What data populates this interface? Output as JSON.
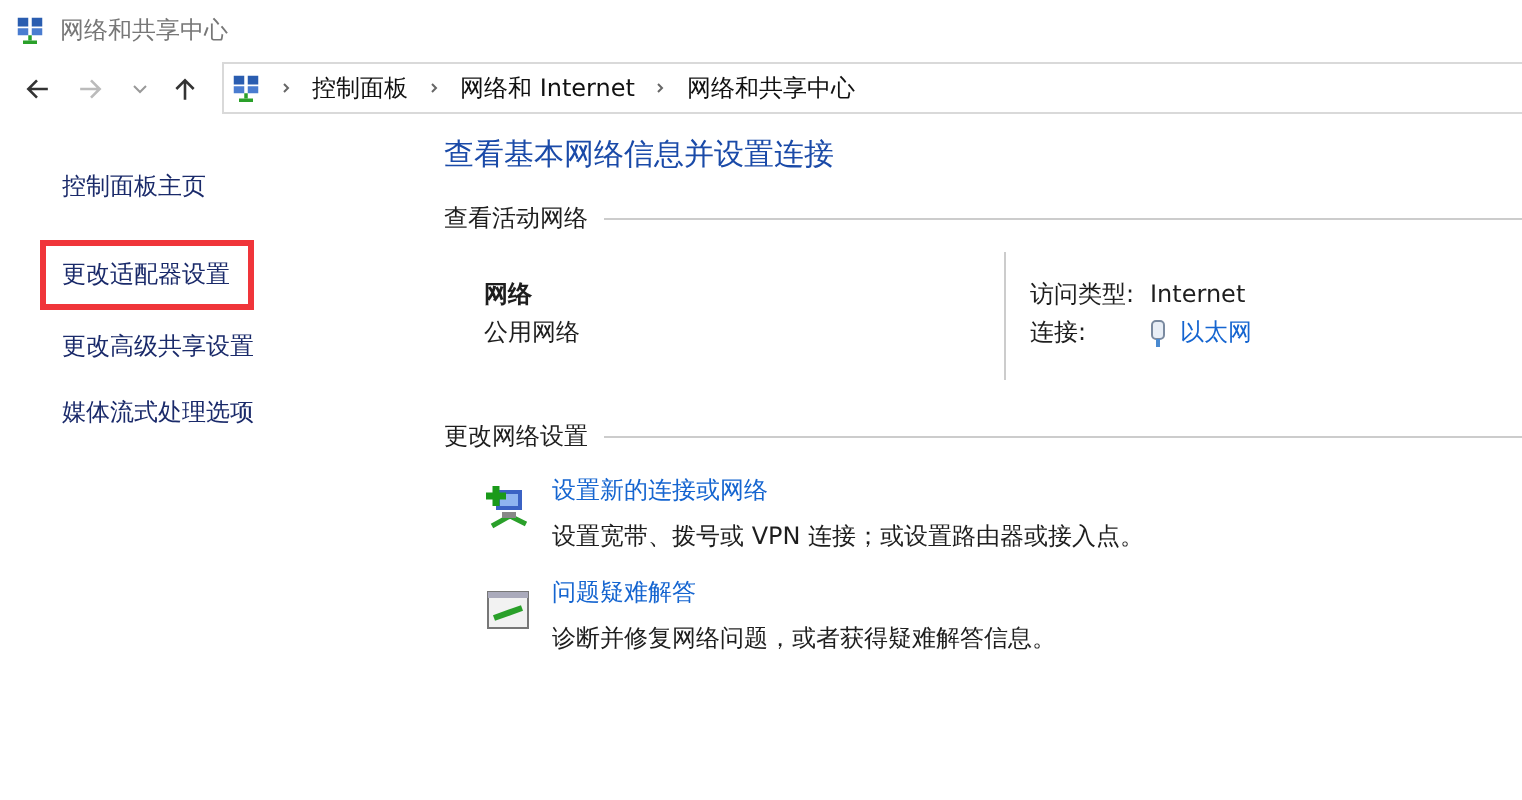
{
  "window": {
    "title": "网络和共享中心"
  },
  "address_bar": {
    "path": [
      "控制面板",
      "网络和 Internet",
      "网络和共享中心"
    ]
  },
  "sidebar": {
    "items": [
      {
        "label": "控制面板主页",
        "highlighted": false
      },
      {
        "label": "更改适配器设置",
        "highlighted": true
      },
      {
        "label": "更改高级共享设置",
        "highlighted": false
      },
      {
        "label": "媒体流式处理选项",
        "highlighted": false
      }
    ]
  },
  "main": {
    "heading": "查看基本网络信息并设置连接",
    "active_networks": {
      "title": "查看活动网络",
      "network_name": "网络",
      "network_type": "公用网络",
      "details": [
        {
          "label": "访问类型:",
          "value": "Internet",
          "kind": "text"
        },
        {
          "label": "连接:",
          "value": "以太网",
          "kind": "link"
        }
      ]
    },
    "change_settings": {
      "title": "更改网络设置",
      "tasks": [
        {
          "kind": "new-connection",
          "link": "设置新的连接或网络",
          "description": "设置宽带、拨号或 VPN 连接；或设置路由器或接入点。"
        },
        {
          "kind": "troubleshoot",
          "link": "问题疑难解答",
          "description": "诊断并修复网络问题，或者获得疑难解答信息。"
        }
      ]
    }
  }
}
